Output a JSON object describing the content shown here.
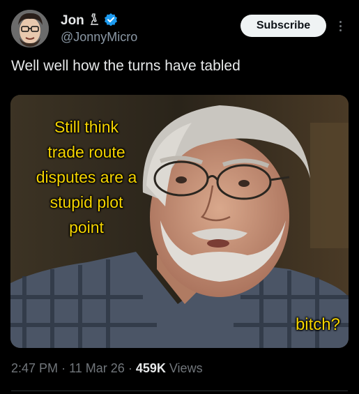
{
  "author": {
    "display_name": "Jon",
    "handle": "@JonnyMicro",
    "badge_icon": "microscope-icon",
    "verified_icon": "verified-badge-icon"
  },
  "actions": {
    "subscribe_label": "Subscribe",
    "more_icon": "more-vertical-icon"
  },
  "tweet": {
    "text": "Well well how the turns have tabled"
  },
  "media": {
    "caption_lines": [
      "Still think",
      "trade route",
      "disputes are a",
      "stupid plot",
      "point"
    ],
    "caption_bottom": "bitch?",
    "caption_color": "#f5d400"
  },
  "meta": {
    "time": "2:47 PM",
    "separator": "·",
    "date": "11 Mar 26",
    "views_count": "459K",
    "views_label": "Views"
  },
  "colors": {
    "background": "#000000",
    "primary_text": "#e7e9ea",
    "secondary_text": "#71767b",
    "verified_blue": "#1d9bf0",
    "button_bg": "#eff3f4"
  }
}
